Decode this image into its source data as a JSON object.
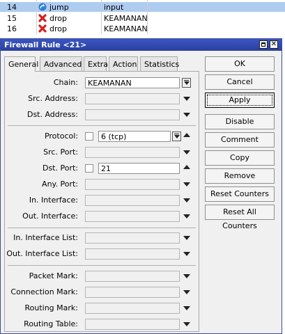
{
  "rules": [
    {
      "num": "14",
      "icon": "jump-icon",
      "action": "jump",
      "chain": "input",
      "selected": true
    },
    {
      "num": "15",
      "icon": "drop-icon",
      "action": "drop",
      "chain": "KEAMANAN",
      "selected": false
    },
    {
      "num": "16",
      "icon": "drop-icon",
      "action": "drop",
      "chain": "KEAMANAN",
      "selected": false
    }
  ],
  "window": {
    "title": "Firewall Rule <21>"
  },
  "tabs": [
    "General",
    "Advanced",
    "Extra",
    "Action",
    "Statistics"
  ],
  "fields": {
    "chain": {
      "label": "Chain:",
      "value": "KEAMANAN"
    },
    "src_address": {
      "label": "Src. Address:",
      "value": ""
    },
    "dst_address": {
      "label": "Dst. Address:",
      "value": ""
    },
    "protocol": {
      "label": "Protocol:",
      "value": "6 (tcp)"
    },
    "src_port": {
      "label": "Src. Port:",
      "value": ""
    },
    "dst_port": {
      "label": "Dst. Port:",
      "value": "21"
    },
    "any_port": {
      "label": "Any. Port:",
      "value": ""
    },
    "in_interface": {
      "label": "In. Interface:",
      "value": ""
    },
    "out_interface": {
      "label": "Out. Interface:",
      "value": ""
    },
    "in_interface_list": {
      "label": "In. Interface List:",
      "value": ""
    },
    "out_interface_list": {
      "label": "Out. Interface List:",
      "value": ""
    },
    "packet_mark": {
      "label": "Packet Mark:",
      "value": ""
    },
    "connection_mark": {
      "label": "Connection Mark:",
      "value": ""
    },
    "routing_mark": {
      "label": "Routing Mark:",
      "value": ""
    },
    "routing_table": {
      "label": "Routing Table:",
      "value": ""
    }
  },
  "buttons": [
    "OK",
    "Cancel",
    "Apply",
    "Disable",
    "Comment",
    "Copy",
    "Remove",
    "Reset Counters",
    "Reset All Counters"
  ]
}
